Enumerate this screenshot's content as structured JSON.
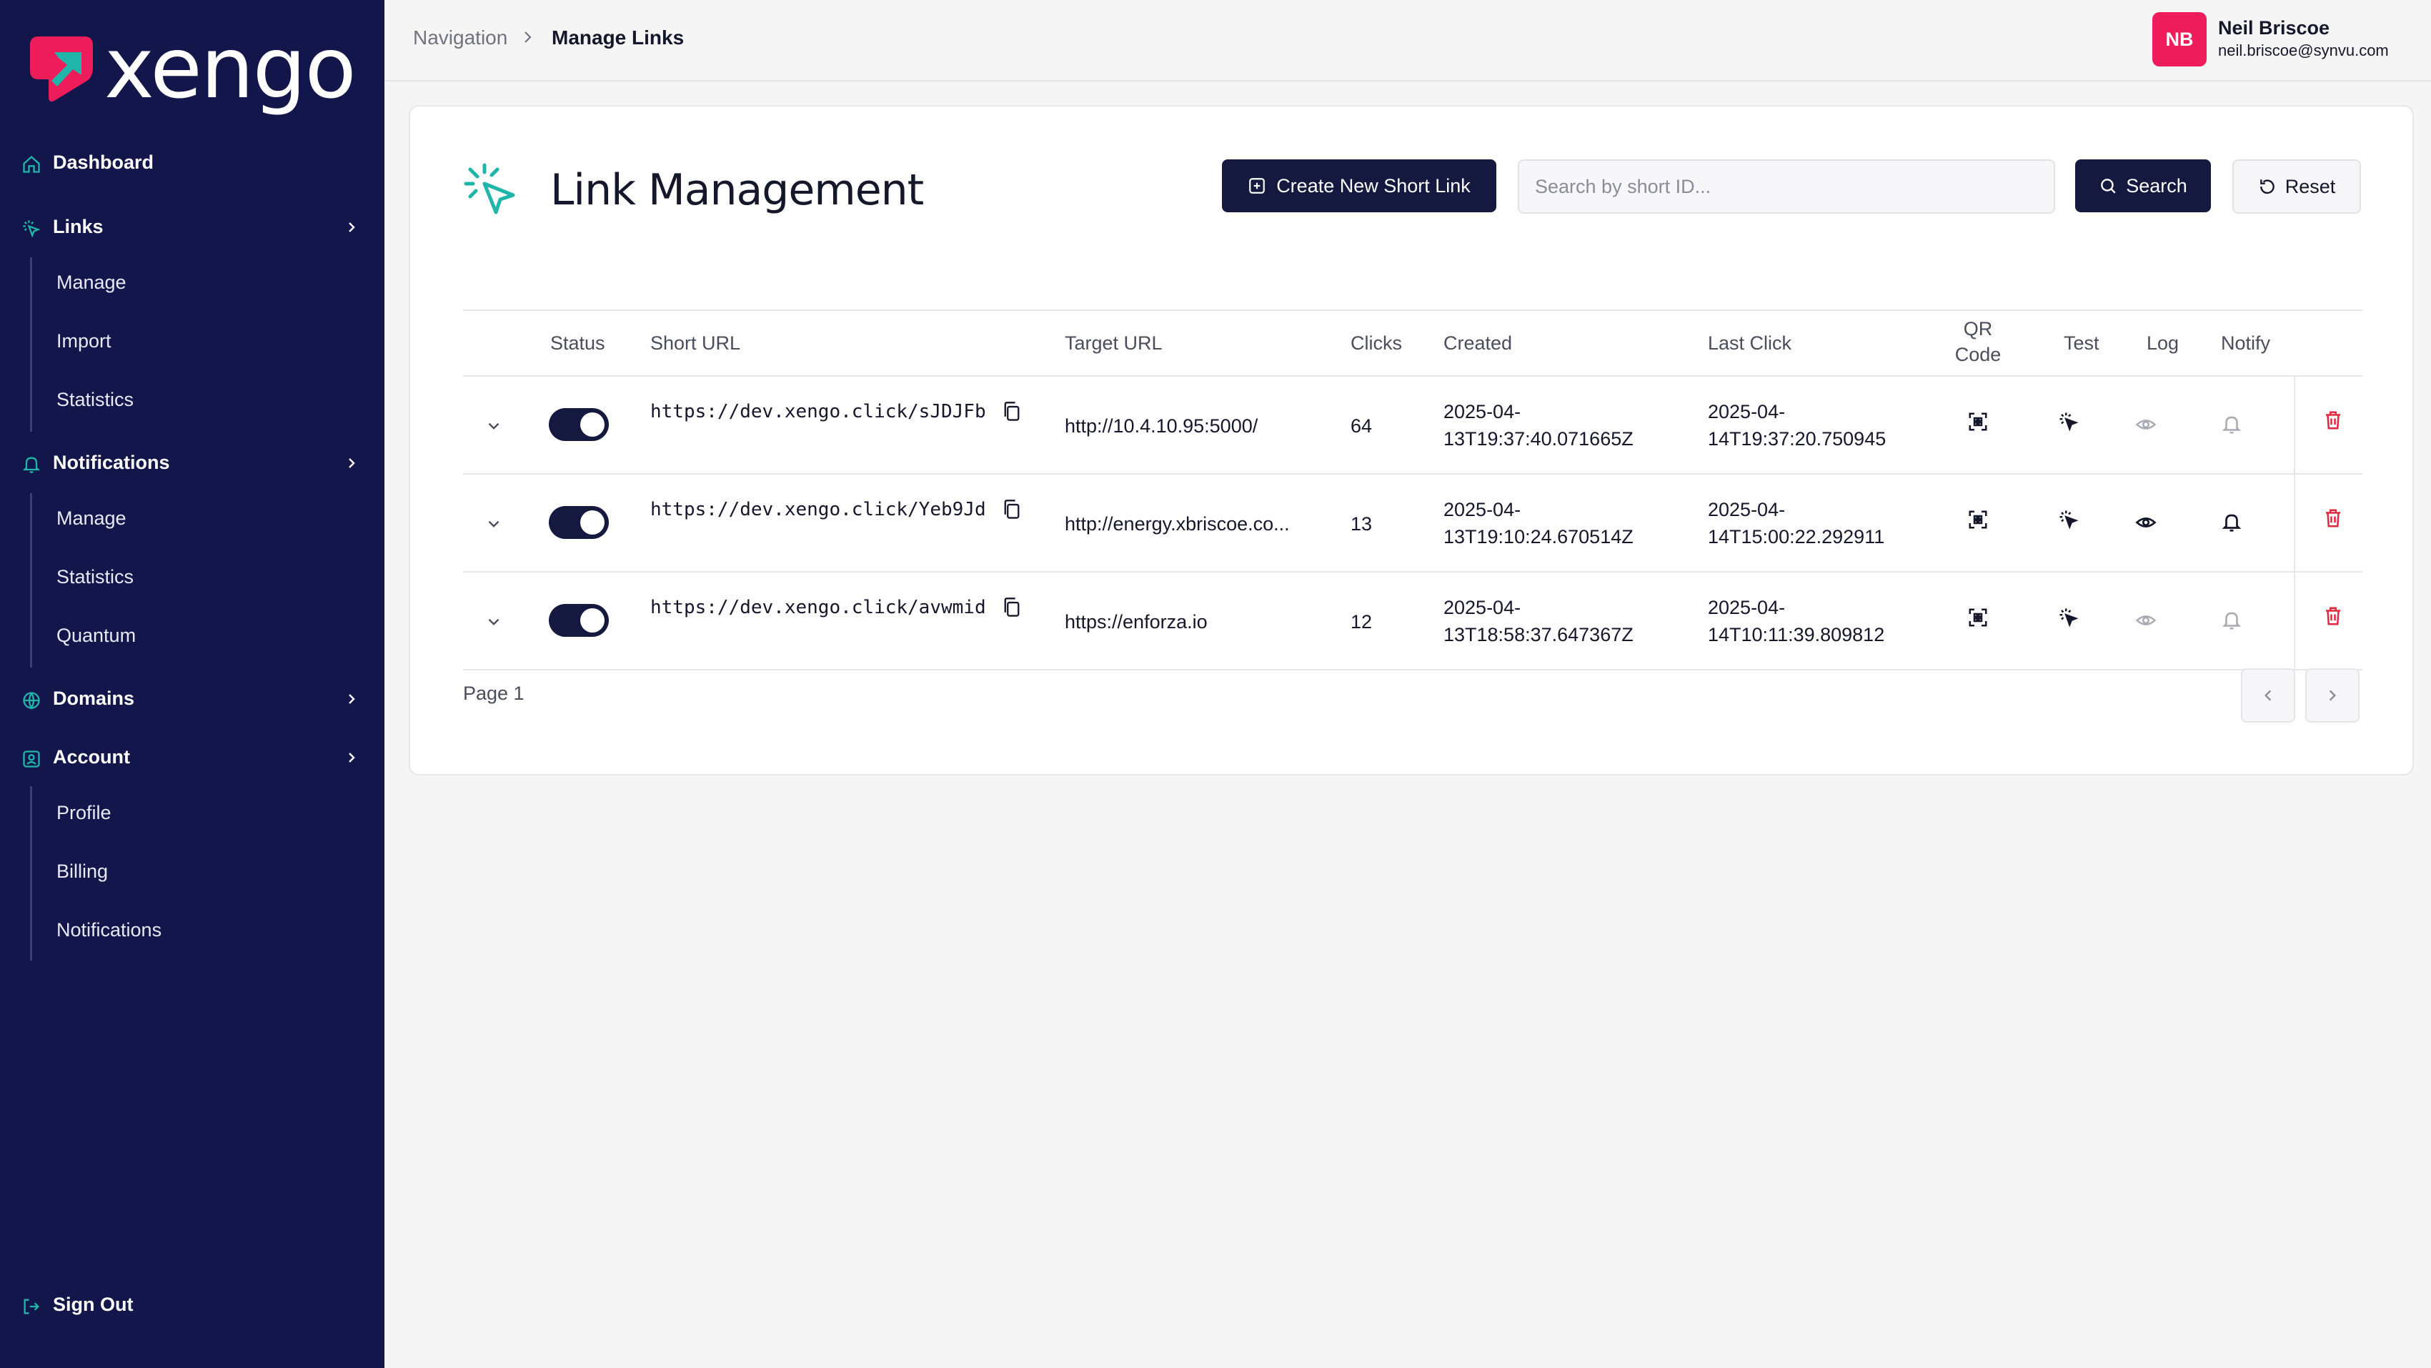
{
  "brand": {
    "name": "xengo",
    "accent": "#ee1c5b",
    "teal": "#1fb6a9",
    "navy": "#13164a"
  },
  "sidebar": {
    "groups": [
      {
        "label": "Dashboard",
        "icon": "home-icon"
      },
      {
        "label": "Links",
        "icon": "cursor-click-icon",
        "items": [
          "Manage",
          "Import",
          "Statistics"
        ]
      },
      {
        "label": "Notifications",
        "icon": "bell-icon",
        "items": [
          "Manage",
          "Statistics",
          "Quantum"
        ]
      },
      {
        "label": "Domains",
        "icon": "globe-icon"
      },
      {
        "label": "Account",
        "icon": "user-square-icon",
        "items": [
          "Profile",
          "Billing",
          "Notifications"
        ]
      }
    ],
    "sign_out": "Sign Out"
  },
  "header": {
    "breadcrumb": {
      "root": "Navigation",
      "current": "Manage Links"
    },
    "user": {
      "initials": "NB",
      "name": "Neil Briscoe",
      "email": "neil.briscoe@synvu.com"
    }
  },
  "main": {
    "title": "Link Management",
    "create_button": "Create New Short Link",
    "search_placeholder": "Search by short ID...",
    "search_button": "Search",
    "reset_button": "Reset",
    "table": {
      "columns": {
        "status": "Status",
        "short_url": "Short URL",
        "target_url": "Target URL",
        "clicks": "Clicks",
        "created": "Created",
        "last_click": "Last Click",
        "qr_line1": "QR",
        "qr_line2": "Code",
        "test": "Test",
        "log": "Log",
        "notify": "Notify"
      },
      "rows": [
        {
          "enabled": true,
          "short_url": "https://dev.xengo.click/sJDJFb",
          "target_url": "http://10.4.10.95:5000/",
          "clicks": "64",
          "created_1": "2025-04-",
          "created_2": "13T19:37:40.071665Z",
          "last_1": "2025-04-",
          "last_2": "14T19:37:20.750945",
          "log_active": false,
          "notify_active": false
        },
        {
          "enabled": true,
          "short_url": "https://dev.xengo.click/Yeb9Jd",
          "target_url": "http://energy.xbriscoe.co...",
          "clicks": "13",
          "created_1": "2025-04-",
          "created_2": "13T19:10:24.670514Z",
          "last_1": "2025-04-",
          "last_2": "14T15:00:22.292911",
          "log_active": true,
          "notify_active": true
        },
        {
          "enabled": true,
          "short_url": "https://dev.xengo.click/avwmid",
          "target_url": "https://enforza.io",
          "clicks": "12",
          "created_1": "2025-04-",
          "created_2": "13T18:58:37.647367Z",
          "last_1": "2025-04-",
          "last_2": "14T10:11:39.809812",
          "log_active": false,
          "notify_active": false
        }
      ]
    },
    "pagination": {
      "label": "Page 1"
    }
  }
}
